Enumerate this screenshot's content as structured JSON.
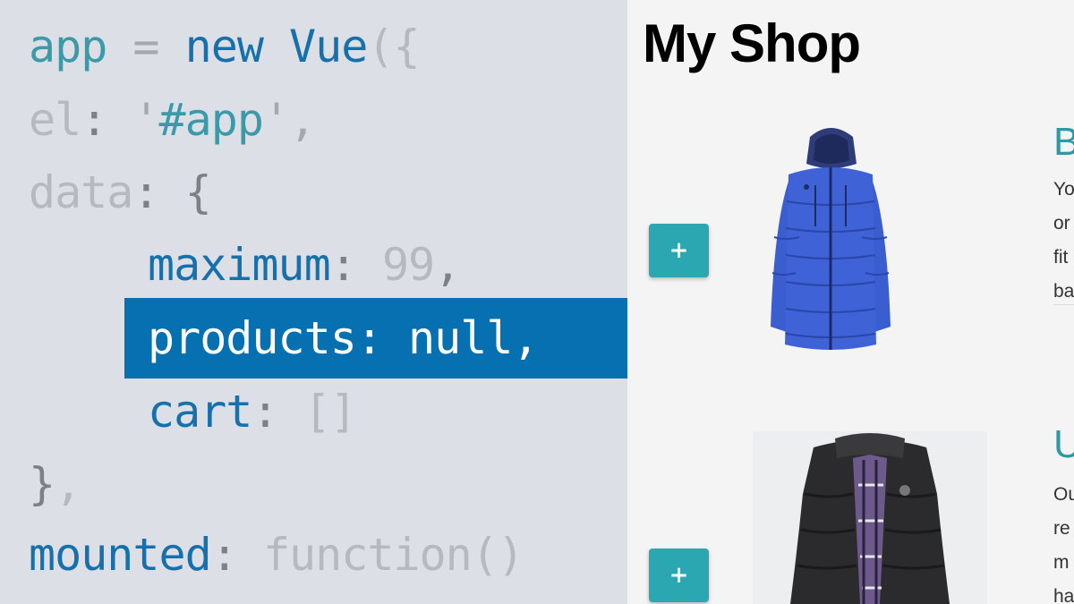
{
  "code": {
    "line1": {
      "ident": "app",
      "eq": " = ",
      "kw": "new",
      "cls": " Vue",
      "paren": "({"
    },
    "line2": {
      "key": "el",
      "colon": ": ",
      "q1": "'",
      "val": "#app",
      "q2": "',"
    },
    "line3": {
      "key": "data",
      "colon": ": ",
      "brace": "{"
    },
    "line4": {
      "key": "maximum",
      "colon": ": ",
      "val": "99",
      "comma": ","
    },
    "line5": {
      "text": "products: null,"
    },
    "line6": {
      "key": "cart",
      "colon": ": ",
      "val": "[]"
    },
    "line7": {
      "brace": "}",
      "comma": ","
    },
    "line8": {
      "key": "mounted",
      "colon": ": ",
      "val": "function()"
    }
  },
  "shop": {
    "title": "My Shop",
    "add_label": "+",
    "products": [
      {
        "heading": "B",
        "desc": "Yo\nor\nfit\nba",
        "image": "blue-puffer-jacket"
      },
      {
        "heading": "U",
        "desc": "Ou\nre\nm\nha",
        "image": "black-puffer-vest"
      }
    ]
  },
  "colors": {
    "code_bg": "#dcdfe6",
    "highlight": "#0670b0",
    "accent": "#2aa7b0",
    "keyword": "#1670ac"
  }
}
